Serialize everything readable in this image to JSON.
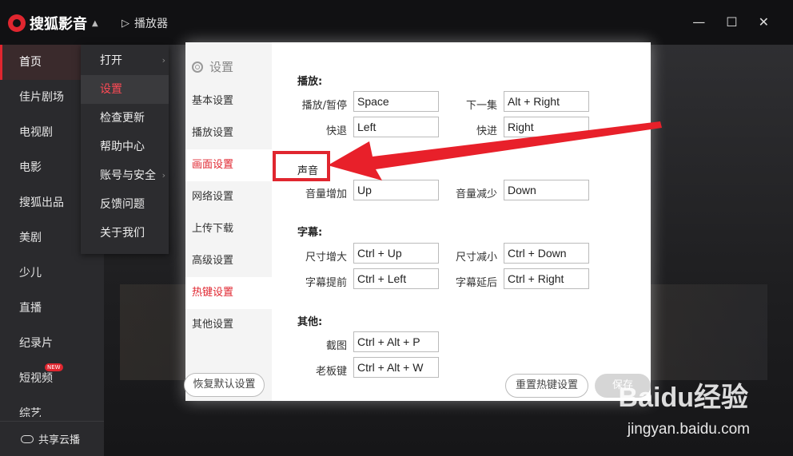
{
  "app": {
    "name": "搜狐影音",
    "player_label": "播放器"
  },
  "left_nav": {
    "items": [
      "首页",
      "佳片剧场",
      "电视剧",
      "电影",
      "搜狐出品",
      "美剧",
      "少儿",
      "直播",
      "纪录片",
      "短视频",
      "综艺"
    ],
    "new_badge": "NEW",
    "bottom": "共享云播"
  },
  "dropdown": {
    "items": [
      "打开",
      "设置",
      "检查更新",
      "帮助中心",
      "账号与安全",
      "反馈问题",
      "关于我们"
    ]
  },
  "settings": {
    "title": "设置",
    "side": [
      "基本设置",
      "播放设置",
      "画面设置",
      "网络设置",
      "上传下载",
      "高级设置",
      "热键设置",
      "其他设置"
    ],
    "restore_btn": "恢复默认设置",
    "sections": {
      "play": {
        "title": "播放:",
        "rows": [
          {
            "label": "播放/暂停",
            "value": "Space",
            "label2": "下一集",
            "value2": "Alt + Right"
          },
          {
            "label": "快退",
            "value": "Left",
            "label2": "快进",
            "value2": "Right"
          }
        ]
      },
      "sound": {
        "title": "声音",
        "rows": [
          {
            "label": "音量增加",
            "value": "Up",
            "label2": "音量减少",
            "value2": "Down"
          }
        ]
      },
      "subtitle": {
        "title": "字幕:",
        "rows": [
          {
            "label": "尺寸增大",
            "value": "Ctrl + Up",
            "label2": "尺寸减小",
            "value2": "Ctrl + Down"
          },
          {
            "label": "字幕提前",
            "value": "Ctrl + Left",
            "label2": "字幕延后",
            "value2": "Ctrl + Right"
          }
        ]
      },
      "other": {
        "title": "其他:",
        "rows": [
          {
            "label": "截图",
            "value": "Ctrl + Alt + P"
          },
          {
            "label": "老板键",
            "value": "Ctrl + Alt + W"
          }
        ]
      }
    },
    "reset_hotkey_btn": "重置热键设置",
    "save_btn": "保存"
  },
  "watermark": {
    "main": "Baidu经验",
    "sub": "jingyan.baidu.com"
  },
  "colors": {
    "accent": "#e0262f",
    "arrow": "#e8202a"
  }
}
